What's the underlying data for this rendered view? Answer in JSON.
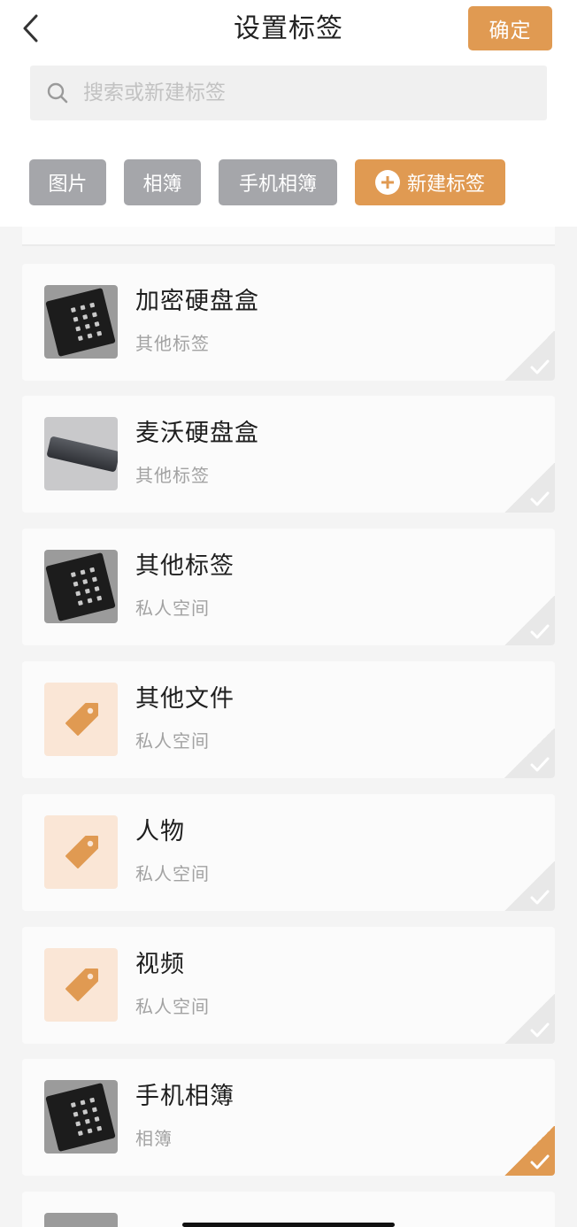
{
  "header": {
    "title": "设置标签",
    "confirm_label": "确定"
  },
  "search": {
    "value": "",
    "placeholder": "搜索或新建标签"
  },
  "chips": [
    {
      "label": "图片"
    },
    {
      "label": "相簿"
    },
    {
      "label": "手机相簿"
    }
  ],
  "new_tag_label": "新建标签",
  "items": [
    {
      "title": "加密硬盘盒",
      "subtitle": "其他标签",
      "thumbnail": "keypad-drive-photo",
      "selected": false
    },
    {
      "title": "麦沃硬盘盒",
      "subtitle": "其他标签",
      "thumbnail": "slim-drive-photo",
      "selected": false
    },
    {
      "title": "其他标签",
      "subtitle": "私人空间",
      "thumbnail": "keypad-drive-photo",
      "selected": false
    },
    {
      "title": "其他文件",
      "subtitle": "私人空间",
      "thumbnail": "tag-icon",
      "selected": false
    },
    {
      "title": "人物",
      "subtitle": "私人空间",
      "thumbnail": "tag-icon",
      "selected": false
    },
    {
      "title": "视频",
      "subtitle": "私人空间",
      "thumbnail": "tag-icon",
      "selected": false
    },
    {
      "title": "手机相簿",
      "subtitle": "相簿",
      "thumbnail": "keypad-drive-photo",
      "selected": true
    }
  ],
  "colors": {
    "accent": "#e09a52",
    "chip_gray": "#a5a6aa",
    "tag_bg": "#fae6d6"
  }
}
